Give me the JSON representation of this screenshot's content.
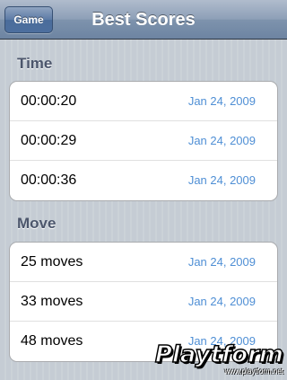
{
  "navbar": {
    "title": "Best Scores",
    "back_label": "Game"
  },
  "sections": [
    {
      "header": "Time",
      "rows": [
        {
          "value": "00:00:20",
          "date": "Jan 24, 2009"
        },
        {
          "value": "00:00:29",
          "date": "Jan 24, 2009"
        },
        {
          "value": "00:00:36",
          "date": "Jan 24, 2009"
        }
      ]
    },
    {
      "header": "Move",
      "rows": [
        {
          "value": "25 moves",
          "date": "Jan 24, 2009"
        },
        {
          "value": "33 moves",
          "date": "Jan 24, 2009"
        },
        {
          "value": "48 moves",
          "date": "Jan 24, 2009"
        }
      ]
    }
  ],
  "watermark": {
    "logo": "Playtform",
    "url": "www.playtform.net"
  },
  "colors": {
    "date_text": "#4f8fd5",
    "section_header": "#4c566c",
    "navbar": "#6d84a2"
  }
}
